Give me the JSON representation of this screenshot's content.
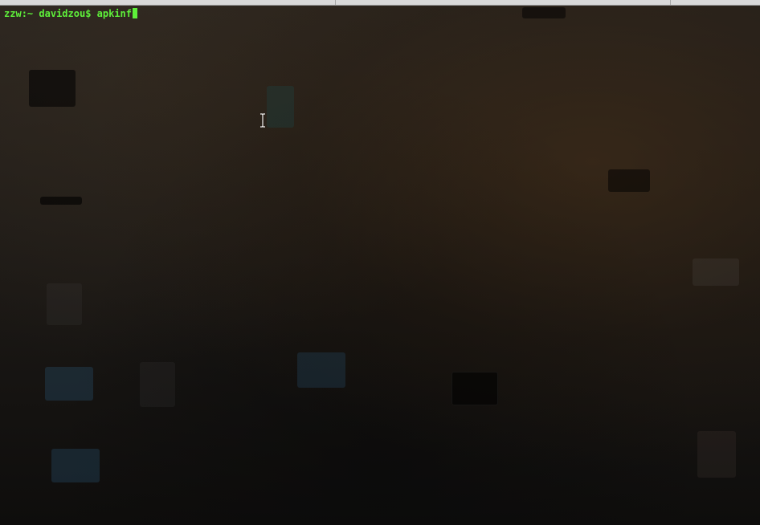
{
  "terminal": {
    "host": "zzw",
    "cwd": "~",
    "user": "davidzou",
    "prompt_symbol": "$",
    "command": "apkinf"
  },
  "colors": {
    "prompt_text": "#5ef03a",
    "cursor": "#5ef03a",
    "background": "#151412"
  },
  "icons": {
    "mouse_pointer": "text-cursor-ibeam-icon"
  }
}
